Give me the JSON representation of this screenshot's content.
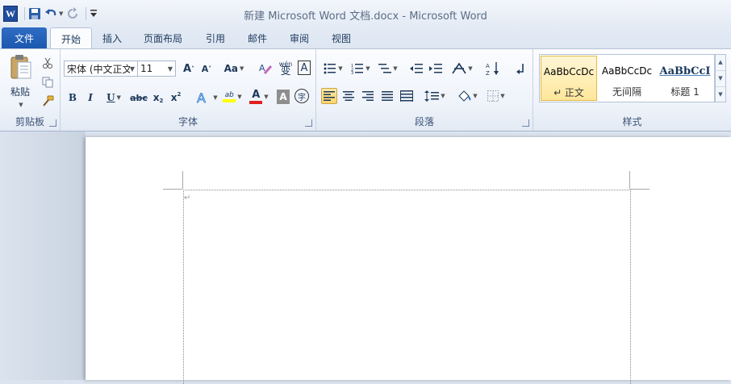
{
  "window": {
    "title": "新建 Microsoft Word 文档.docx  -  Microsoft Word"
  },
  "quick_access": {
    "app_icon_letter": "W",
    "items": [
      "save-icon",
      "undo-icon",
      "redo-icon",
      "customize-icon"
    ]
  },
  "tabs": {
    "file": "文件",
    "items": [
      "开始",
      "插入",
      "页面布局",
      "引用",
      "邮件",
      "审阅",
      "视图"
    ],
    "active": "开始"
  },
  "clipboard": {
    "paste_label": "粘贴",
    "group_label": "剪贴板"
  },
  "font": {
    "font_name": "宋体 (中文正文)",
    "font_size": "11",
    "case_label": "Aa",
    "wen_label": "wén",
    "bian_label": "变",
    "border_char_label": "A",
    "bold": "B",
    "italic": "I",
    "underline": "U",
    "strike": "abc",
    "subscript": "x",
    "superscript": "x",
    "highlight_label": "ab",
    "font_color_label": "A",
    "shading_label": "A",
    "enclose_label": "字",
    "group_label": "字体"
  },
  "paragraph": {
    "group_label": "段落"
  },
  "styles": {
    "items": [
      {
        "sample": "AaBbCcDc",
        "name": "↵ 正文",
        "selected": true
      },
      {
        "sample": "AaBbCcDc",
        "name": "无间隔",
        "selected": false
      },
      {
        "sample": "AaBbCcI",
        "name": "标题 1",
        "selected": false
      }
    ],
    "group_label": "样式"
  },
  "document": {
    "paragraph_mark": "↵"
  },
  "colors": {
    "accent": "#2b6bc5",
    "highlight": "#ffff00",
    "font_color": "#e02020"
  }
}
